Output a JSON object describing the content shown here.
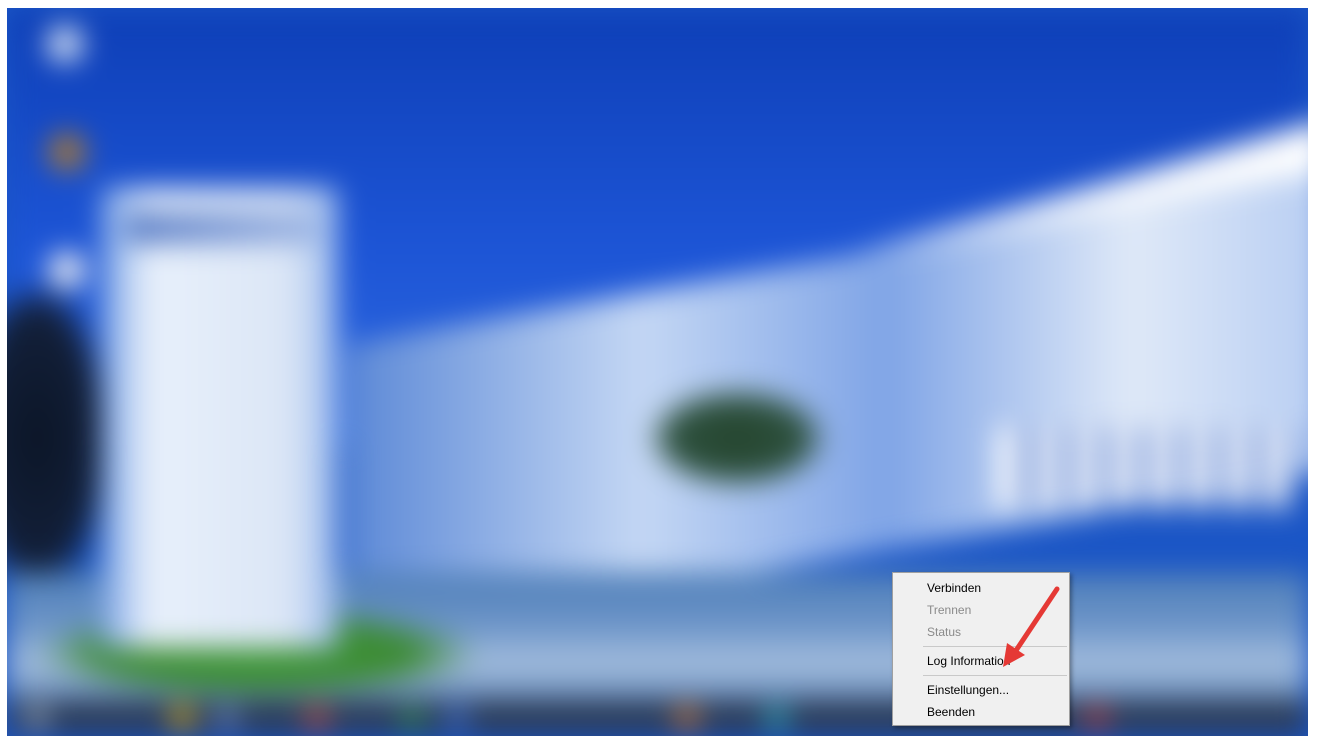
{
  "context_menu": {
    "items": [
      {
        "label": "Verbinden",
        "enabled": true
      },
      {
        "label": "Trennen",
        "enabled": false
      },
      {
        "label": "Status",
        "enabled": false
      },
      {
        "label": "Log Information",
        "enabled": true
      },
      {
        "label": "Einstellungen...",
        "enabled": true
      },
      {
        "label": "Beenden",
        "enabled": true
      }
    ]
  },
  "annotation": {
    "color": "#e53935"
  },
  "colors": {
    "menu_background": "#f0f0f0",
    "menu_border": "#a0a0a0",
    "disabled_text": "#8a8a8a"
  }
}
